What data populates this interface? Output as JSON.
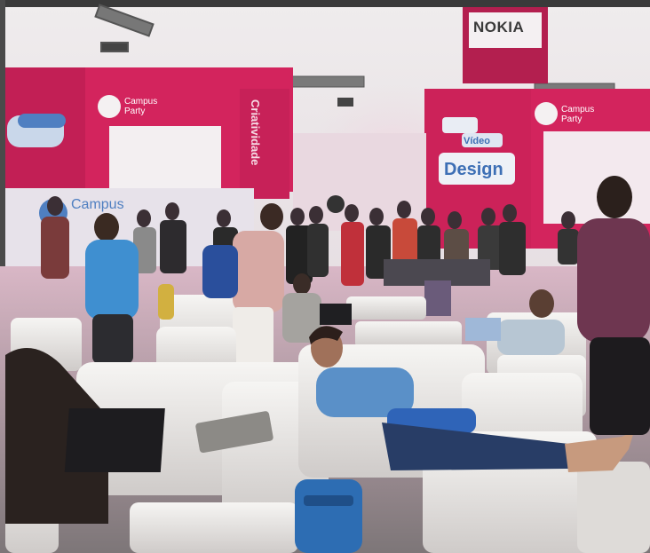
{
  "signs": {
    "nokia": "NOKIA",
    "campus_party_left": "Campus Party",
    "campus_party_right": "Campus Party",
    "campus_low": "Campus",
    "vertical_banner": "Criatividade",
    "design_word_1": "Vídeo",
    "design_word_2": "Design"
  },
  "colors": {
    "magenta": "#d3245d",
    "white_furniture": "#f1f0ee",
    "ceiling": "#ebe7e9"
  }
}
